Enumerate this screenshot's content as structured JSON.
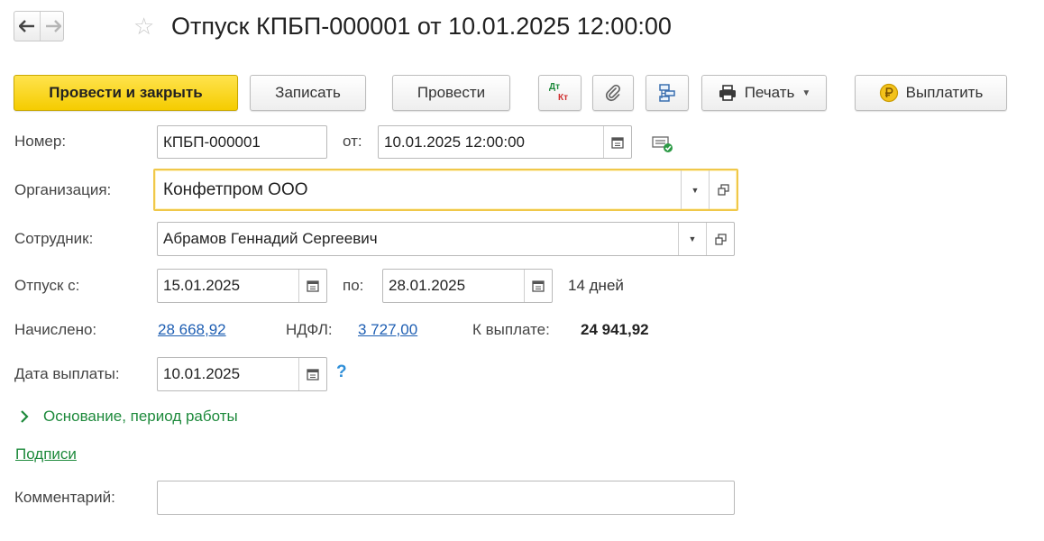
{
  "header": {
    "title": "Отпуск КПБП-000001 от 10.01.2025 12:00:00"
  },
  "toolbar": {
    "post_close_label": "Провести и закрыть",
    "save_label": "Записать",
    "post_label": "Провести",
    "dt_label": "Дт",
    "kt_label": "Кт",
    "print_label": "Печать",
    "pay_label": "Выплатить"
  },
  "form": {
    "number_label": "Номер:",
    "number_value": "КПБП-000001",
    "date_from_label": "от:",
    "date_value": "10.01.2025 12:00:00",
    "organization_label": "Организация:",
    "organization_value": "Конфетпром ООО",
    "employee_label": "Сотрудник:",
    "employee_value": "Абрамов Геннадий Сергеевич",
    "vacation_from_label": "Отпуск с:",
    "vacation_from_value": "15.01.2025",
    "vacation_to_label": "по:",
    "vacation_to_value": "28.01.2025",
    "days_text": "14 дней",
    "accrued_label": "Начислено:",
    "accrued_value": "28 668,92",
    "ndfl_label": "НДФЛ:",
    "ndfl_value": "3 727,00",
    "to_pay_label": "К выплате:",
    "to_pay_value": "24 941,92",
    "pay_date_label": "Дата выплаты:",
    "pay_date_value": "10.01.2025",
    "help_glyph": "?",
    "basis_label": "Основание, период работы",
    "signatures_label": "Подписи",
    "comment_label": "Комментарий:",
    "comment_value": ""
  },
  "colors": {
    "primary": "#f5cc00",
    "link": "#1f5fb3",
    "green": "#1e8a3c",
    "focus_border": "#f0c84a"
  }
}
